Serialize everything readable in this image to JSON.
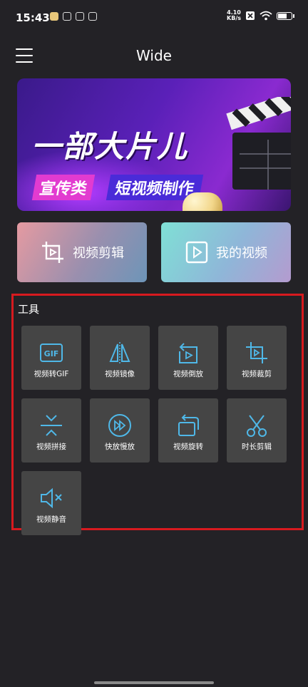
{
  "status_bar": {
    "time": "15:43",
    "net_speed_value": "4.10",
    "net_speed_unit": "KB/s"
  },
  "header": {
    "title": "Wide"
  },
  "banner": {
    "headline": "一部大片儿",
    "tag1": "宣传类",
    "tag2": "短视频制作"
  },
  "actions": {
    "edit_label": "视频剪辑",
    "my_videos_label": "我的视频"
  },
  "tools": {
    "title": "工具",
    "items": [
      {
        "label": "视频转GIF",
        "icon": "gif-icon"
      },
      {
        "label": "视频镜像",
        "icon": "mirror-icon"
      },
      {
        "label": "视频倒放",
        "icon": "reverse-icon"
      },
      {
        "label": "视频裁剪",
        "icon": "crop-icon"
      },
      {
        "label": "视频拼接",
        "icon": "merge-icon"
      },
      {
        "label": "快放慢放",
        "icon": "speed-icon"
      },
      {
        "label": "视频旋转",
        "icon": "rotate-icon"
      },
      {
        "label": "时长剪辑",
        "icon": "scissors-icon"
      },
      {
        "label": "视频静音",
        "icon": "mute-icon"
      }
    ]
  },
  "colors": {
    "background": "#232226",
    "tile": "#454545",
    "icon_accent": "#4fb8e8",
    "highlight_border": "#d71a1f"
  }
}
